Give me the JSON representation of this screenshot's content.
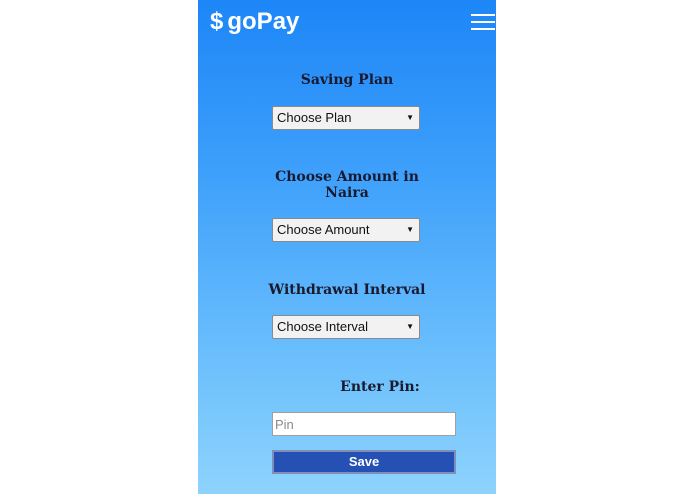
{
  "app": {
    "logo_symbol": "$",
    "logo_text": "goPay",
    "menu_icon": "hamburger-menu-icon"
  },
  "form": {
    "saving_plan_label": "Saving Plan",
    "plan_select_value": "Choose Plan",
    "amount_label_line1": "Choose Amount in",
    "amount_label_line2": "Naira",
    "amount_select_value": "Choose Amount",
    "interval_label": "Withdrawal Interval",
    "interval_select_value": "Choose Interval",
    "pin_label": "Enter Pin:",
    "pin_placeholder": "Pin",
    "save_label": "Save"
  },
  "colors": {
    "gradient_top": "#1d86f7",
    "gradient_bottom": "#8ed3fd",
    "save_button": "#2451b3"
  }
}
